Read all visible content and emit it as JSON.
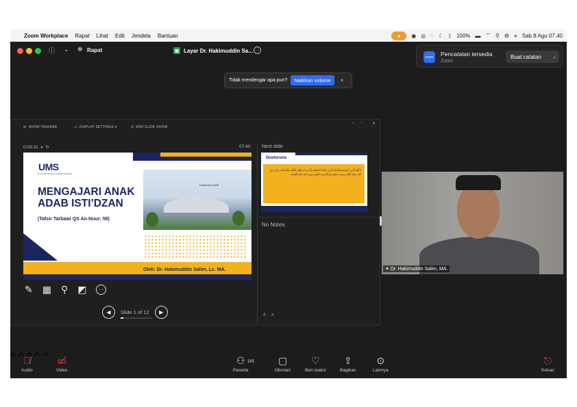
{
  "menubar": {
    "app": "Zoom Workplace",
    "items": [
      "Rapat",
      "Lihat",
      "Edit",
      "Jendela",
      "Bantuan"
    ],
    "battery": "100%",
    "datetime": "Sab 8 Agu 07.40"
  },
  "titlebar": {
    "meeting_label": "Rapat",
    "share_label": "Layar Dr. Hakimuddin Sa..."
  },
  "recording_toast": {
    "title": "Pencatatan tersedia",
    "subtitle": "Zoom",
    "button": "Buat catatan",
    "icon_text": "zoom"
  },
  "volume_notice": {
    "text": "Tidak mendengar apa pun?",
    "button": "Naikkan volume",
    "close": "×"
  },
  "presenter": {
    "toolbar": [
      "SHOW TASKBAR",
      "DISPLAY SETTINGS ▾",
      "END SLIDE SHOW"
    ],
    "timer": "0:03:31",
    "clock": "07:40",
    "next_label": "Next slide",
    "notes": "No Notes.",
    "font_up": "A",
    "font_down": "A",
    "slide_counter": "Slide 1 of 12",
    "progress": 0.083
  },
  "slide": {
    "logo": "UMS",
    "logo_sub": "Universitas Muhammadiyah Surakarta",
    "title": "MENGAJARI ANAK ADAB ISTI’DZAN",
    "subtitle": "(Tafsir Tarbawi QS An-Nuur: 58)",
    "author": "Oleh: Dr. Hakimuddin Salim, Lc. MA.",
    "building_sign": "Edutorium UMS"
  },
  "next_slide": {
    "title": "Dusturuna",
    "arabic": "يَا أَيُّهَا الَّذِينَ آمَنُوا لِيَسْتَأْذِنْكُمُ الَّذِينَ مَلَكَتْ أَيْمَانُكُمْ وَالَّذِينَ لَمْ يَبْلُغُوا الْحُلُمَ مِنْكُمْ ثَلَاثَ مَرَّاتٍ مِنْ قَبْلِ صَلَاةِ الْفَجْرِ وَحِينَ تَضَعُونَ ثِيَابَكُمْ مِنَ الظَّهِيرَةِ وَمِنْ بَعْدِ صَلَاةِ الْعِشَاءِ"
  },
  "video": {
    "name": "Dr. Hakimuddin Salim, MA."
  },
  "bottombar": {
    "audio": "Audio",
    "video": "Video",
    "participants": "Peserta",
    "participants_count": "185",
    "chat": "Obrolan",
    "react": "Beri reaksi",
    "share": "Bagikan",
    "more": "Lainnya",
    "leave": "Keluar"
  },
  "colors": {
    "ums_navy": "#1b2660",
    "ums_gold": "#f3b21b",
    "zoom_blue": "#2d6cf6",
    "leave_red": "#e5484d"
  }
}
